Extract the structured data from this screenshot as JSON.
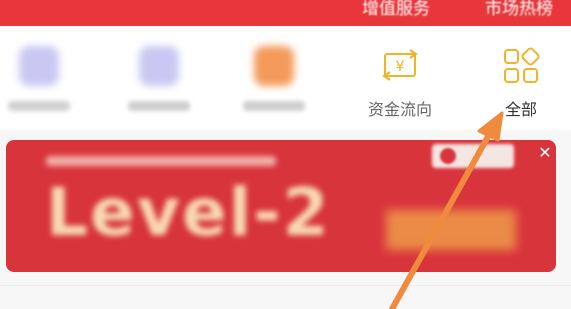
{
  "topbar": {
    "tabs": [
      "增值服务",
      "市场热榜"
    ]
  },
  "icon_row": {
    "items": [
      {
        "label": "",
        "icon": "blurred-icon",
        "color": "#c9c8f2"
      },
      {
        "label": "",
        "icon": "blurred-icon",
        "color": "#c9c8f2"
      },
      {
        "label": "",
        "icon": "blurred-icon",
        "color": "#f49a5a"
      },
      {
        "label": "资金流向",
        "icon": "money-flow-icon",
        "color": "#f0b429"
      },
      {
        "label": "全部",
        "icon": "grid-icon",
        "color": "#f0b429"
      }
    ]
  },
  "banner": {
    "headline": "Level-2",
    "background": "#d8343c"
  },
  "annotation": {
    "arrow_color": "#f08a3c"
  }
}
